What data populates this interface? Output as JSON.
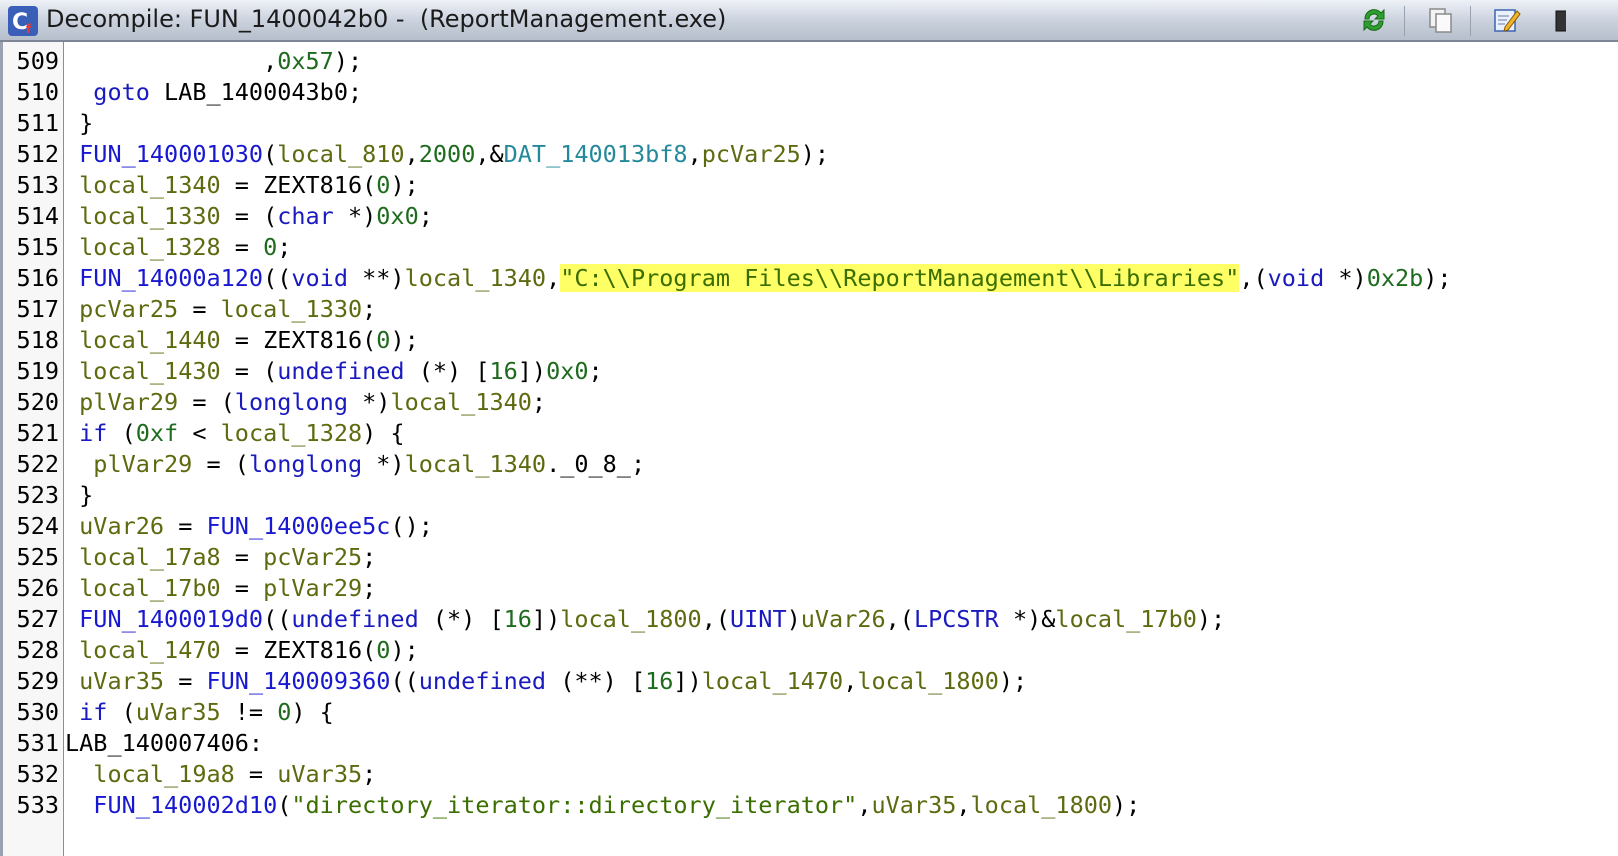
{
  "window": {
    "title": "Decompile: FUN_1400042b0 -  (ReportManagement.exe)",
    "icons": [
      "ghidra-decompiler-icon",
      "refresh-icon",
      "copy-icon",
      "edit-icon",
      "snapshot-icon"
    ]
  },
  "code": {
    "lines": [
      {
        "num": "509",
        "indent": "              ",
        "tokens": [
          {
            "t": ",",
            "c": "op"
          },
          {
            "t": "0x57",
            "c": "num"
          },
          {
            "t": ");",
            "c": "op"
          }
        ]
      },
      {
        "num": "510",
        "indent": "  ",
        "tokens": [
          {
            "t": "goto",
            "c": "kw"
          },
          {
            "t": " LAB_1400043b0;",
            "c": "op"
          }
        ]
      },
      {
        "num": "511",
        "indent": " ",
        "tokens": [
          {
            "t": "}",
            "c": "op"
          }
        ]
      },
      {
        "num": "512",
        "indent": " ",
        "tokens": [
          {
            "t": "FUN_140001030",
            "c": "fn"
          },
          {
            "t": "(",
            "c": "op"
          },
          {
            "t": "local_810",
            "c": "var"
          },
          {
            "t": ",",
            "c": "op"
          },
          {
            "t": "2000",
            "c": "num"
          },
          {
            "t": ",&",
            "c": "op"
          },
          {
            "t": "DAT_140013bf8",
            "c": "dat"
          },
          {
            "t": ",",
            "c": "op"
          },
          {
            "t": "pcVar25",
            "c": "var"
          },
          {
            "t": ");",
            "c": "op"
          }
        ]
      },
      {
        "num": "513",
        "indent": " ",
        "tokens": [
          {
            "t": "local_1340",
            "c": "var"
          },
          {
            "t": " = ZEXT816(",
            "c": "op"
          },
          {
            "t": "0",
            "c": "num"
          },
          {
            "t": ");",
            "c": "op"
          }
        ]
      },
      {
        "num": "514",
        "indent": " ",
        "tokens": [
          {
            "t": "local_1330",
            "c": "var"
          },
          {
            "t": " = (",
            "c": "op"
          },
          {
            "t": "char",
            "c": "type"
          },
          {
            "t": " *)",
            "c": "op"
          },
          {
            "t": "0x0",
            "c": "num"
          },
          {
            "t": ";",
            "c": "op"
          }
        ]
      },
      {
        "num": "515",
        "indent": " ",
        "tokens": [
          {
            "t": "local_1328",
            "c": "var"
          },
          {
            "t": " = ",
            "c": "op"
          },
          {
            "t": "0",
            "c": "num"
          },
          {
            "t": ";",
            "c": "op"
          }
        ]
      },
      {
        "num": "516",
        "indent": " ",
        "tokens": [
          {
            "t": "FUN_14000a120",
            "c": "fn"
          },
          {
            "t": "((",
            "c": "op"
          },
          {
            "t": "void",
            "c": "type"
          },
          {
            "t": " **)",
            "c": "op"
          },
          {
            "t": "local_1340",
            "c": "var"
          },
          {
            "t": ",",
            "c": "op"
          },
          {
            "t": "\"C:\\\\Program Files\\\\ReportManagement\\\\Libraries\"",
            "c": "str hl"
          },
          {
            "t": ",(",
            "c": "op"
          },
          {
            "t": "void",
            "c": "type"
          },
          {
            "t": " *)",
            "c": "op"
          },
          {
            "t": "0x2b",
            "c": "num"
          },
          {
            "t": ");",
            "c": "op"
          }
        ]
      },
      {
        "num": "517",
        "indent": " ",
        "tokens": [
          {
            "t": "pcVar25",
            "c": "var"
          },
          {
            "t": " = ",
            "c": "op"
          },
          {
            "t": "local_1330",
            "c": "var"
          },
          {
            "t": ";",
            "c": "op"
          }
        ]
      },
      {
        "num": "518",
        "indent": " ",
        "tokens": [
          {
            "t": "local_1440",
            "c": "var"
          },
          {
            "t": " = ZEXT816(",
            "c": "op"
          },
          {
            "t": "0",
            "c": "num"
          },
          {
            "t": ");",
            "c": "op"
          }
        ]
      },
      {
        "num": "519",
        "indent": " ",
        "tokens": [
          {
            "t": "local_1430",
            "c": "var"
          },
          {
            "t": " = (",
            "c": "op"
          },
          {
            "t": "undefined",
            "c": "type"
          },
          {
            "t": " (*) [",
            "c": "op"
          },
          {
            "t": "16",
            "c": "num"
          },
          {
            "t": "])",
            "c": "op"
          },
          {
            "t": "0x0",
            "c": "num"
          },
          {
            "t": ";",
            "c": "op"
          }
        ]
      },
      {
        "num": "520",
        "indent": " ",
        "tokens": [
          {
            "t": "plVar29",
            "c": "var"
          },
          {
            "t": " = (",
            "c": "op"
          },
          {
            "t": "longlong",
            "c": "type"
          },
          {
            "t": " *)",
            "c": "op"
          },
          {
            "t": "local_1340",
            "c": "var"
          },
          {
            "t": ";",
            "c": "op"
          }
        ]
      },
      {
        "num": "521",
        "indent": " ",
        "tokens": [
          {
            "t": "if",
            "c": "kw"
          },
          {
            "t": " (",
            "c": "op"
          },
          {
            "t": "0xf",
            "c": "num"
          },
          {
            "t": " < ",
            "c": "op"
          },
          {
            "t": "local_1328",
            "c": "var"
          },
          {
            "t": ") {",
            "c": "op"
          }
        ]
      },
      {
        "num": "522",
        "indent": "  ",
        "tokens": [
          {
            "t": "plVar29",
            "c": "var"
          },
          {
            "t": " = (",
            "c": "op"
          },
          {
            "t": "longlong",
            "c": "type"
          },
          {
            "t": " *)",
            "c": "op"
          },
          {
            "t": "local_1340",
            "c": "var"
          },
          {
            "t": "._0_8_;",
            "c": "op"
          }
        ]
      },
      {
        "num": "523",
        "indent": " ",
        "tokens": [
          {
            "t": "}",
            "c": "op"
          }
        ]
      },
      {
        "num": "524",
        "indent": " ",
        "tokens": [
          {
            "t": "uVar26",
            "c": "var"
          },
          {
            "t": " = ",
            "c": "op"
          },
          {
            "t": "FUN_14000ee5c",
            "c": "fn"
          },
          {
            "t": "();",
            "c": "op"
          }
        ]
      },
      {
        "num": "525",
        "indent": " ",
        "tokens": [
          {
            "t": "local_17a8",
            "c": "var"
          },
          {
            "t": " = ",
            "c": "op"
          },
          {
            "t": "pcVar25",
            "c": "var"
          },
          {
            "t": ";",
            "c": "op"
          }
        ]
      },
      {
        "num": "526",
        "indent": " ",
        "tokens": [
          {
            "t": "local_17b0",
            "c": "var"
          },
          {
            "t": " = ",
            "c": "op"
          },
          {
            "t": "plVar29",
            "c": "var"
          },
          {
            "t": ";",
            "c": "op"
          }
        ]
      },
      {
        "num": "527",
        "indent": " ",
        "tokens": [
          {
            "t": "FUN_1400019d0",
            "c": "fn"
          },
          {
            "t": "((",
            "c": "op"
          },
          {
            "t": "undefined",
            "c": "type"
          },
          {
            "t": " (*) [",
            "c": "op"
          },
          {
            "t": "16",
            "c": "num"
          },
          {
            "t": "])",
            "c": "op"
          },
          {
            "t": "local_1800",
            "c": "var"
          },
          {
            "t": ",(",
            "c": "op"
          },
          {
            "t": "UINT",
            "c": "type"
          },
          {
            "t": ")",
            "c": "op"
          },
          {
            "t": "uVar26",
            "c": "var"
          },
          {
            "t": ",(",
            "c": "op"
          },
          {
            "t": "LPCSTR",
            "c": "type"
          },
          {
            "t": " *)&",
            "c": "op"
          },
          {
            "t": "local_17b0",
            "c": "var"
          },
          {
            "t": ");",
            "c": "op"
          }
        ]
      },
      {
        "num": "528",
        "indent": " ",
        "tokens": [
          {
            "t": "local_1470",
            "c": "var"
          },
          {
            "t": " = ZEXT816(",
            "c": "op"
          },
          {
            "t": "0",
            "c": "num"
          },
          {
            "t": ");",
            "c": "op"
          }
        ]
      },
      {
        "num": "529",
        "indent": " ",
        "tokens": [
          {
            "t": "uVar35",
            "c": "var"
          },
          {
            "t": " = ",
            "c": "op"
          },
          {
            "t": "FUN_140009360",
            "c": "fn"
          },
          {
            "t": "((",
            "c": "op"
          },
          {
            "t": "undefined",
            "c": "type"
          },
          {
            "t": " (**) [",
            "c": "op"
          },
          {
            "t": "16",
            "c": "num"
          },
          {
            "t": "])",
            "c": "op"
          },
          {
            "t": "local_1470",
            "c": "var"
          },
          {
            "t": ",",
            "c": "op"
          },
          {
            "t": "local_1800",
            "c": "var"
          },
          {
            "t": ");",
            "c": "op"
          }
        ]
      },
      {
        "num": "530",
        "indent": " ",
        "tokens": [
          {
            "t": "if",
            "c": "kw"
          },
          {
            "t": " (",
            "c": "op"
          },
          {
            "t": "uVar35",
            "c": "var"
          },
          {
            "t": " != ",
            "c": "op"
          },
          {
            "t": "0",
            "c": "num"
          },
          {
            "t": ") {",
            "c": "op"
          }
        ]
      },
      {
        "num": "531",
        "indent": "",
        "tokens": [
          {
            "t": "LAB_140007406:",
            "c": "op"
          }
        ]
      },
      {
        "num": "532",
        "indent": "  ",
        "tokens": [
          {
            "t": "local_19a8",
            "c": "var"
          },
          {
            "t": " = ",
            "c": "op"
          },
          {
            "t": "uVar35",
            "c": "var"
          },
          {
            "t": ";",
            "c": "op"
          }
        ]
      },
      {
        "num": "533",
        "indent": "  ",
        "tokens": [
          {
            "t": "FUN_140002d10",
            "c": "fn"
          },
          {
            "t": "(",
            "c": "op"
          },
          {
            "t": "\"directory_iterator::directory_iterator\"",
            "c": "str"
          },
          {
            "t": ",",
            "c": "op"
          },
          {
            "t": "uVar35",
            "c": "var"
          },
          {
            "t": ",",
            "c": "op"
          },
          {
            "t": "local_1800",
            "c": "var"
          },
          {
            "t": ");",
            "c": "op"
          }
        ]
      }
    ]
  }
}
